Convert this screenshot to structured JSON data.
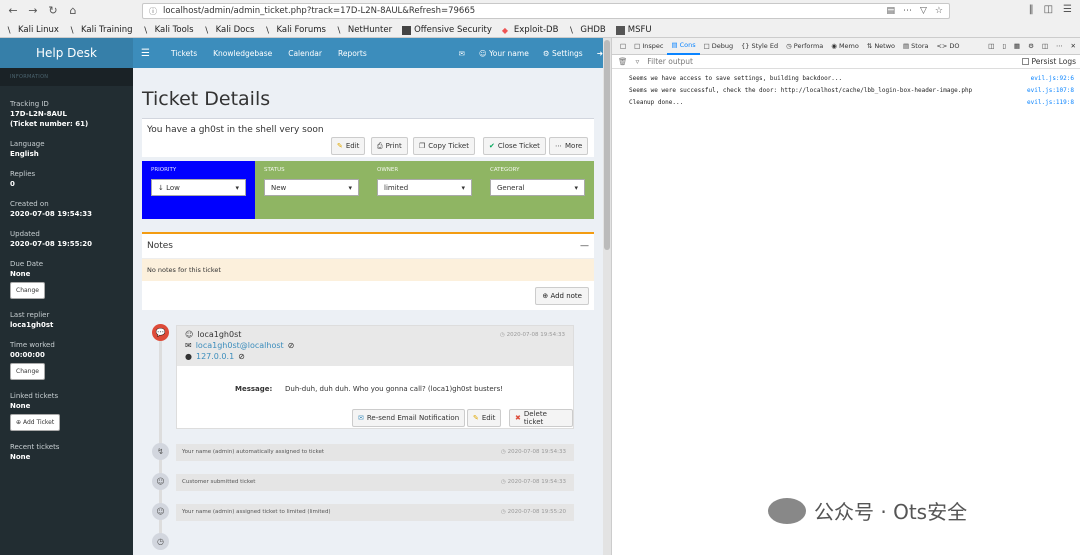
{
  "browser": {
    "url": "localhost/admin/admin_ticket.php?track=17D-L2N-8AUL&Refresh=79665",
    "bookmarks": [
      "Kali Linux",
      "Kali Training",
      "Kali Tools",
      "Kali Docs",
      "Kali Forums",
      "NetHunter",
      "Offensive Security",
      "Exploit-DB",
      "GHDB",
      "MSFU"
    ]
  },
  "app": {
    "brand": "Help Desk",
    "nav": [
      "Tickets",
      "Knowledgebase",
      "Calendar",
      "Reports"
    ],
    "user": "Your name",
    "settings": "Settings"
  },
  "sidebar": {
    "section": "INFORMATION",
    "tracking_label": "Tracking ID",
    "tracking_value": "17D-L2N-8AUL",
    "ticket_number": "(Ticket number: 61)",
    "language_label": "Language",
    "language_value": "English",
    "replies_label": "Replies",
    "replies_value": "0",
    "created_label": "Created on",
    "created_value": "2020-07-08 19:54:33",
    "updated_label": "Updated",
    "updated_value": "2020-07-08 19:55:20",
    "due_label": "Due Date",
    "due_value": "None",
    "change": "Change",
    "last_replier_label": "Last replier",
    "last_replier_value": "loca1gh0st",
    "time_label": "Time worked",
    "time_value": "00:00:00",
    "linked_label": "Linked tickets",
    "linked_value": "None",
    "add_ticket": "Add Ticket",
    "recent_label": "Recent tickets",
    "recent_value": "None"
  },
  "ticket": {
    "title": "Ticket Details",
    "subject": "You have a gh0st in the shell very soon",
    "actions": [
      "Edit",
      "Print",
      "Copy Ticket",
      "Close Ticket",
      "More"
    ],
    "fields": [
      {
        "label": "PRIORITY",
        "value": "Low",
        "color": "#0000ff"
      },
      {
        "label": "STATUS",
        "value": "New",
        "color": "#8fb563"
      },
      {
        "label": "OWNER",
        "value": "limited",
        "color": "#8fb563"
      },
      {
        "label": "CATEGORY",
        "value": "General",
        "color": "#8fb563"
      }
    ],
    "notes_title": "Notes",
    "notes_empty": "No notes for this ticket",
    "add_note": "Add note",
    "message": {
      "name": "loca1gh0st",
      "email": "loca1gh0st@localhost",
      "ip": "127.0.0.1",
      "time": "2020-07-08 19:54:33",
      "label": "Message:",
      "text": "Duh-duh, duh duh. Who you gonna call? (loca1)gh0st busters!",
      "buttons": [
        "Re-send Email Notification",
        "Edit",
        "Delete ticket"
      ]
    },
    "events": [
      {
        "text": "Your name (admin) automatically assigned to ticket",
        "time": "2020-07-08 19:54:33"
      },
      {
        "text": "Customer submitted ticket",
        "time": "2020-07-08 19:54:33"
      },
      {
        "text": "Your name (admin) assigned ticket to limited (limited)",
        "time": "2020-07-08 19:55:20"
      }
    ]
  },
  "devtools": {
    "tabs": [
      "Inspec",
      "Cons",
      "Debug",
      "Style Ed",
      "Performa",
      "Memo",
      "Netwo",
      "Stora",
      "DO"
    ],
    "filter_placeholder": "Filter output",
    "persist": "Persist Logs",
    "logs": [
      {
        "text": "Seems we have access to save settings, building backdoor...",
        "src": "evil.js:92:6"
      },
      {
        "text": "Seems we were successful, check the door: http://localhost/cache/lbb_login-box-header-image.php",
        "src": "evil.js:107:8"
      },
      {
        "text": "Cleanup done...",
        "src": "evil.js:119:8"
      }
    ]
  },
  "watermark": "公众号 · Ots安全"
}
